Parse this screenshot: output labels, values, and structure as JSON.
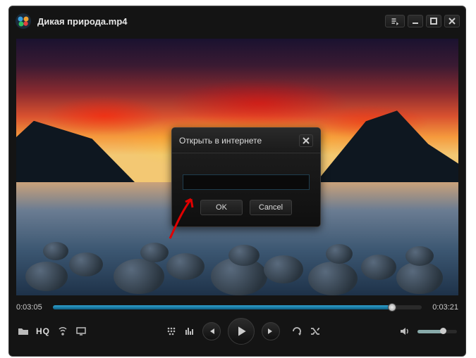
{
  "titlebar": {
    "title": "Дикая природа.mp4"
  },
  "dialog": {
    "title": "Открыть в интернете",
    "url_value": "",
    "ok_label": "OK",
    "cancel_label": "Cancel"
  },
  "playback": {
    "current_time": "0:03:05",
    "total_time": "0:03:21",
    "progress_pct": 92,
    "volume_pct": 65,
    "hq_label": "HQ"
  }
}
